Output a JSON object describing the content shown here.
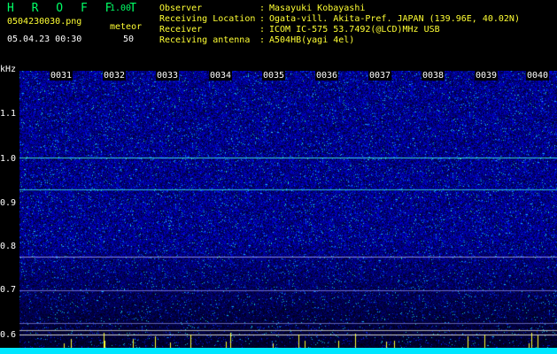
{
  "header": {
    "app_title": "H R O F F T",
    "version": "1.00",
    "filename": "0504230030.png",
    "mode": "meteor",
    "datetime": "05.04.23 00:30",
    "mode_value": "50"
  },
  "info": [
    {
      "label": "Observer",
      "value": "Masayuki Kobayashi"
    },
    {
      "label": "Receiving Location",
      "value": "Ogata-vill. Akita-Pref. JAPAN (139.96E, 40.02N)"
    },
    {
      "label": "Receiver",
      "value": "ICOM IC-575 53.7492(@LCD)MHz USB"
    },
    {
      "label": "Receiving antenna",
      "value": "A504HB(yagi 4el)"
    }
  ],
  "axis": {
    "unit": "kHz",
    "y_ticks": [
      "1.1",
      "1.0",
      "0.9",
      "0.8",
      "0.7",
      "0.6"
    ],
    "time_ticks": [
      "0031",
      "0032",
      "0033",
      "0034",
      "0035",
      "0036",
      "0037",
      "0038",
      "0039",
      "0040"
    ]
  },
  "colors": {
    "background": "#000000",
    "title_green": "#00ff66",
    "label_yellow": "#ffff33",
    "noise_blue": "#1a2ad8",
    "signal_cyan": "#00e6ff"
  }
}
